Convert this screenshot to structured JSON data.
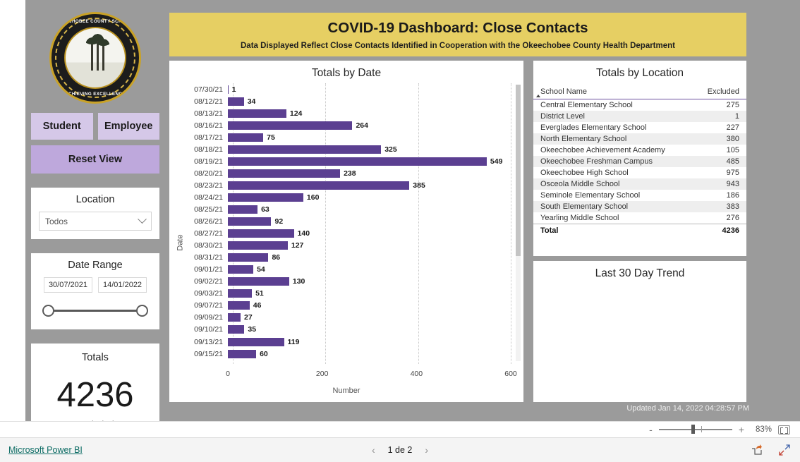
{
  "banner": {
    "title": "COVID-19 Dashboard: Close Contacts",
    "subtitle": "Data Displayed Reflect Close Contacts Identified in Cooperation with the Okeechobee County Health Department",
    "bg_color": "#e6cf63"
  },
  "sidebar": {
    "logo": {
      "icon": "okeechobee-county-schools-seal",
      "text_top": "OKEECHOBEE COUNTY SCHOOLS",
      "text_bottom": "ACHIEVING EXCELLENCE"
    },
    "buttons": {
      "student": "Student",
      "employee": "Employee",
      "reset": "Reset View"
    },
    "location_filter": {
      "title": "Location",
      "selected": "Todos",
      "chevron_icon": "chevron-down-icon"
    },
    "date_range": {
      "title": "Date Range",
      "start": "30/07/2021",
      "end": "14/01/2022"
    },
    "totals": {
      "title": "Totals",
      "value": "4236",
      "label": "Excluded"
    }
  },
  "chart_panel": {
    "title": "Totals by Date"
  },
  "chart_data": {
    "type": "bar",
    "orientation": "horizontal",
    "title": "Totals by Date",
    "xlabel": "Number",
    "ylabel": "Date",
    "xlim": [
      0,
      600
    ],
    "xticks": [
      0,
      200,
      400,
      600
    ],
    "grid": true,
    "bar_color": "#5b3f91",
    "categories": [
      "07/30/21",
      "08/12/21",
      "08/13/21",
      "08/16/21",
      "08/17/21",
      "08/18/21",
      "08/19/21",
      "08/20/21",
      "08/23/21",
      "08/24/21",
      "08/25/21",
      "08/26/21",
      "08/27/21",
      "08/30/21",
      "08/31/21",
      "09/01/21",
      "09/02/21",
      "09/03/21",
      "09/07/21",
      "09/09/21",
      "09/10/21",
      "09/13/21",
      "09/15/21"
    ],
    "values": [
      1,
      34,
      124,
      264,
      75,
      325,
      549,
      238,
      385,
      160,
      63,
      92,
      140,
      127,
      86,
      54,
      130,
      51,
      46,
      27,
      35,
      119,
      60
    ]
  },
  "location_table": {
    "title": "Totals by Location",
    "columns": [
      "School Name",
      "Excluded"
    ],
    "sort": "ascending",
    "rows": [
      {
        "name": "Central Elementary School",
        "excluded": "275"
      },
      {
        "name": "District Level",
        "excluded": "1"
      },
      {
        "name": "Everglades Elementary School",
        "excluded": "227"
      },
      {
        "name": "North Elementary School",
        "excluded": "380"
      },
      {
        "name": "Okeechobee Achievement Academy",
        "excluded": "105"
      },
      {
        "name": "Okeechobee Freshman Campus",
        "excluded": "485"
      },
      {
        "name": "Okeechobee High School",
        "excluded": "975"
      },
      {
        "name": "Osceola Middle School",
        "excluded": "943"
      },
      {
        "name": "Seminole Elementary School",
        "excluded": "186"
      },
      {
        "name": "South Elementary School",
        "excluded": "383"
      },
      {
        "name": "Yearling Middle School",
        "excluded": "276"
      }
    ],
    "total_label": "Total",
    "total_value": "4236"
  },
  "trend_panel": {
    "title": "Last 30 Day Trend"
  },
  "updated_text": "Updated Jan 14, 2022 04:28:57 PM",
  "statusbar": {
    "zoom_minus": "-",
    "zoom_plus": "+",
    "zoom_level": "83%",
    "fit_icon": "fit-to-page-icon"
  },
  "footer": {
    "brand": "Microsoft Power BI",
    "prev_icon": "chevron-left-icon",
    "next_icon": "chevron-right-icon",
    "page_text": "1 de 2",
    "share_icon": "share-icon",
    "fullscreen_icon": "fullscreen-icon"
  }
}
